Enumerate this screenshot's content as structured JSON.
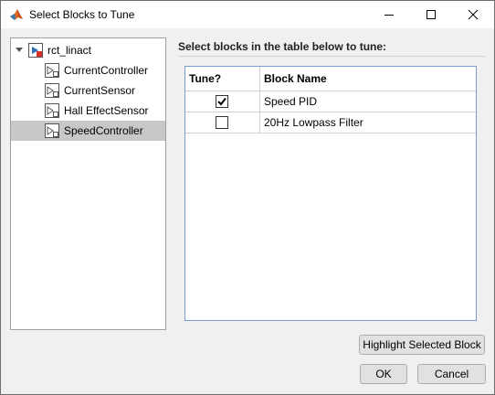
{
  "window": {
    "title": "Select Blocks to Tune"
  },
  "tree": {
    "root": {
      "label": "rct_linact",
      "expanded": true
    },
    "children": [
      {
        "label": "CurrentController",
        "selected": false
      },
      {
        "label": "CurrentSensor",
        "selected": false
      },
      {
        "label": "Hall EffectSensor",
        "selected": false
      },
      {
        "label": "SpeedController",
        "selected": true
      }
    ]
  },
  "panel": {
    "heading": "Select blocks in the table below to tune:",
    "columns": [
      "Tune?",
      "Block Name"
    ],
    "rows": [
      {
        "tune": true,
        "name": "Speed PID"
      },
      {
        "tune": false,
        "name": "20Hz Lowpass Filter"
      }
    ]
  },
  "buttons": {
    "highlight": "Highlight Selected Block",
    "ok": "OK",
    "cancel": "Cancel"
  },
  "icons": {
    "app": "matlab-icon",
    "block": "subsystem-block-icon",
    "expand": "expand-triangle-icon"
  }
}
